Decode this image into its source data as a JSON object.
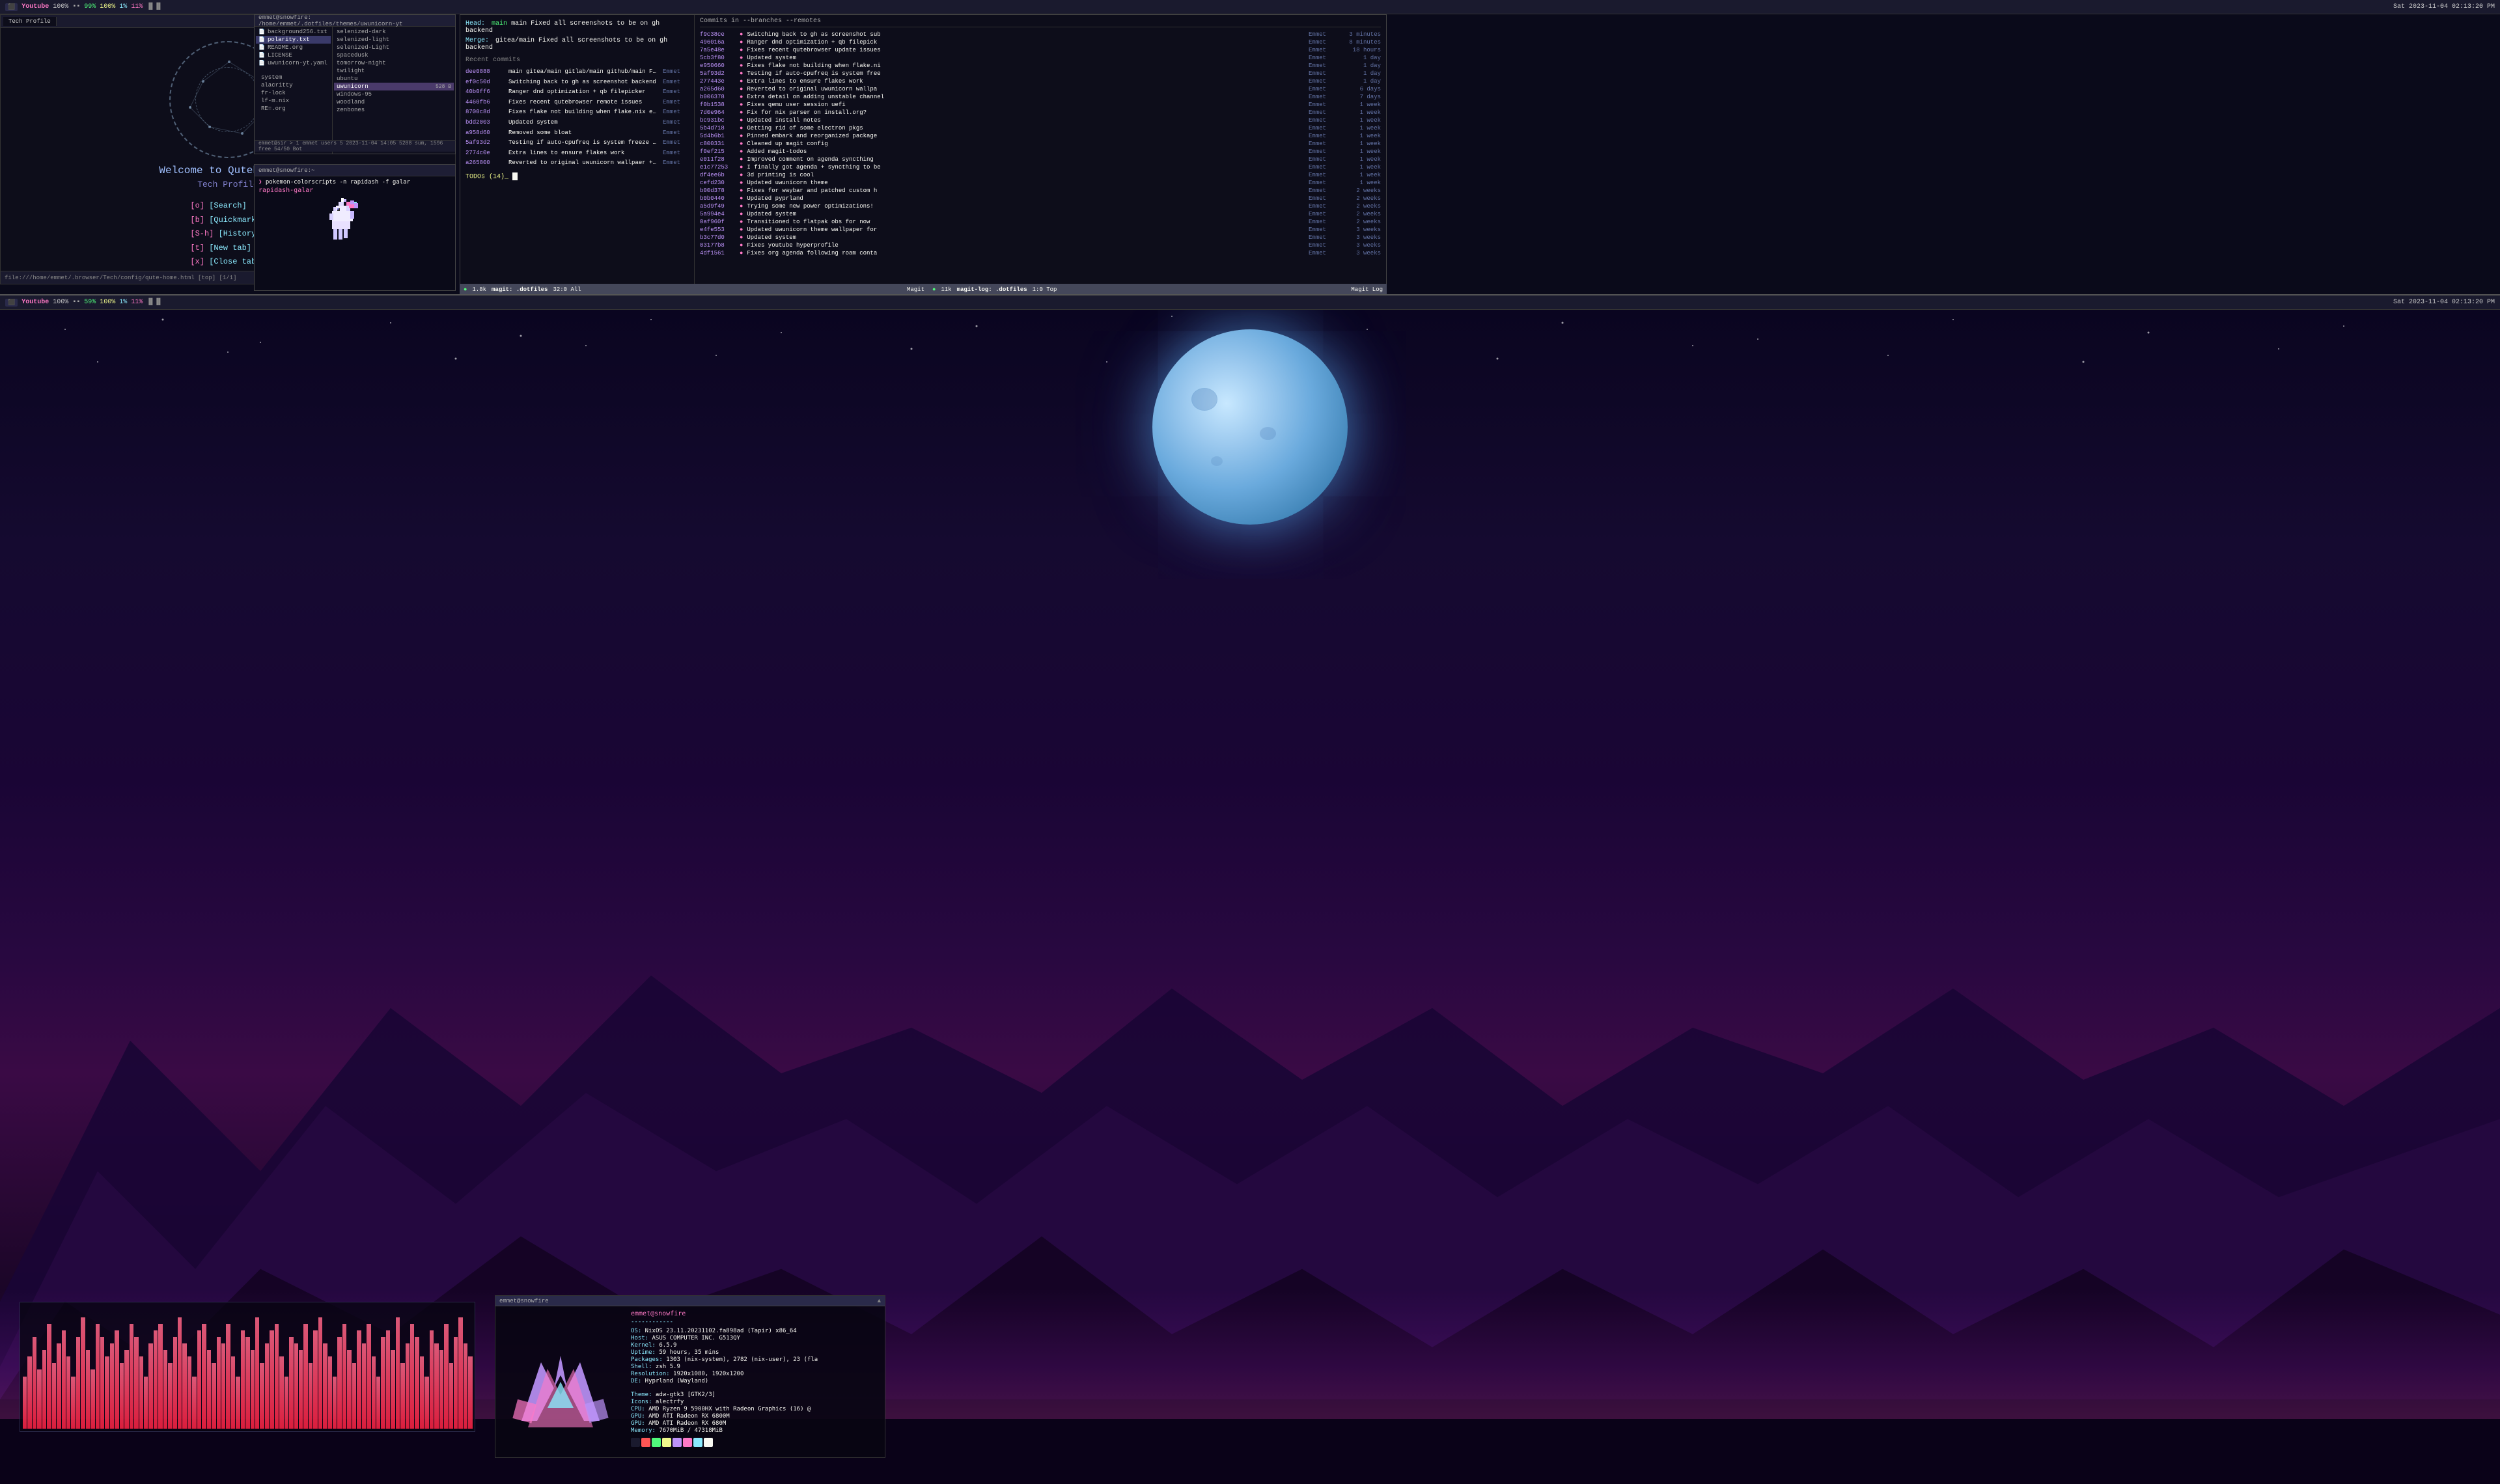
{
  "monitor1": {
    "topbar": {
      "left": {
        "app": "Youtube",
        "workspace": "100%",
        "cpu": "99%",
        "mem": "100%",
        "temp": "1%",
        "net": "11%"
      },
      "right": {
        "datetime": "Sat 2023-11-04 02:13:20 PM",
        "workspace_icons": "⬛▪▪"
      }
    }
  },
  "monitor2": {
    "topbar": {
      "left": {
        "app": "Youtube",
        "workspace": "100%",
        "cpu": "59%",
        "mem": "100%",
        "temp": "1%",
        "net": "11%"
      },
      "right": {
        "datetime": "Sat 2023-11-04 02:13:20 PM"
      }
    }
  },
  "qutebrowser": {
    "tab": "Tech Profile",
    "url": "file:///home/emmet/.browser/Tech/config/qute-home.html [top] [1/1]",
    "welcome": "Welcome to Qutebrowser",
    "subtitle": "Tech Profile",
    "menu": [
      {
        "key": "[o]",
        "label": "[Search]"
      },
      {
        "key": "[b]",
        "label": "[Quickmarks]"
      },
      {
        "key": "[S-h]",
        "label": "[History]"
      },
      {
        "key": "[t]",
        "label": "[New tab]"
      },
      {
        "key": "[x]",
        "label": "[Close tab]"
      }
    ]
  },
  "filemanager": {
    "title": "emmet@snowfire: /home/emmet/.dotfiles/themes/uwunicorn-yt",
    "left_items": [
      {
        "name": "background256.txt",
        "selected": false
      },
      {
        "name": "polarity.txt",
        "selected": true
      },
      {
        "name": "README.org",
        "selected": false
      },
      {
        "name": "LICENSE",
        "selected": false
      },
      {
        "name": "uwunicorn-yt.yaml",
        "selected": false
      }
    ],
    "right_items": [
      {
        "name": "system",
        "value": "selenized-dark"
      },
      {
        "name": "alacritty",
        "value": "selenized-light"
      },
      {
        "name": "fr-lock",
        "value": "selenized-Light"
      },
      {
        "name": "lf-m.nix",
        "value": "spacedusk"
      },
      {
        "name": "RE=.org",
        "value": "tomorrow-night"
      },
      {
        "name": "",
        "value": "twilight"
      },
      {
        "name": "",
        "value": "ubuntu"
      },
      {
        "name": "",
        "value": "uwunicorn"
      },
      {
        "name": "",
        "value": "windows-95"
      },
      {
        "name": "",
        "value": "woodland"
      },
      {
        "name": "",
        "value": "zenbones"
      }
    ],
    "statusbar": "emmet@sir > 1 emmet users 5 2023-11-04 14:05 5288 sum, 1596 free 54/50 Bot"
  },
  "pokemon_term": {
    "title": "emmet@snowfire:~",
    "prompt": "rapidash-galar",
    "command": "pokemon-colorscripts -n rapidash -f galar"
  },
  "git": {
    "head": "main Fixed all screenshots to be on gh backend",
    "merge": "gitea/main Fixed all screenshots to be on gh backend",
    "recent_commits_title": "Recent commits",
    "commits": [
      {
        "hash": "dee0888",
        "msg": "main gitea/main gitlab/main github/main Fixed all screenshots to be on",
        "author": "Emmet",
        "time": ""
      },
      {
        "hash": "ef0c50d",
        "msg": "Switching back to gh as screenshot backend",
        "author": "Emmet",
        "time": ""
      },
      {
        "hash": "40b0ff6",
        "msg": "Ranger dnd optimization + qb filepicker",
        "author": "Emmet",
        "time": ""
      },
      {
        "hash": "4460fb6",
        "msg": "Fixes recent qutebrowser remote issues",
        "author": "Emmet",
        "time": ""
      },
      {
        "hash": "8700c8d",
        "msg": "Fixes flake not building when flake.nix editor is vim, nvim or nano",
        "author": "Emmet",
        "time": ""
      },
      {
        "hash": "bdd2003",
        "msg": "Updated system",
        "author": "Emmet",
        "time": ""
      },
      {
        "hash": "a958d60",
        "msg": "Removed some bloat",
        "author": "Emmet",
        "time": ""
      },
      {
        "hash": "5af93d2",
        "msg": "Testing if auto-cpufreq is system freeze culprit",
        "author": "Emmet",
        "time": ""
      },
      {
        "hash": "2774c0e",
        "msg": "Extra lines to ensure flakes work",
        "author": "Emmet",
        "time": ""
      },
      {
        "hash": "a265800",
        "msg": "Reverted to original uwunicorn wallpaer + uwunicorn yt wallpaper vari",
        "author": "Emmet",
        "time": ""
      }
    ],
    "todos": "TODOs (14)_",
    "status_bar": {
      "left": "1.8k",
      "branch": "magit: .dotfiles",
      "right": "32:0 All",
      "mode": "Magit"
    }
  },
  "git_log": {
    "title": "Commits in --branches --remotes",
    "entries": [
      {
        "hash": "f9c38ce",
        "msg": "Switching back to gh as screenshot sub",
        "author": "Emmet",
        "time": "3 minutes"
      },
      {
        "hash": "496016a",
        "msg": "Ranger dnd optimization + qb filepick",
        "author": "Emmet",
        "time": "8 minutes"
      },
      {
        "hash": "7a5e48e",
        "msg": "Fixes recent qutebrowser update issues",
        "author": "Emmet",
        "time": "18 hours"
      },
      {
        "hash": "5cb3f80",
        "msg": "Updated system",
        "author": "Emmet",
        "time": "1 day"
      },
      {
        "hash": "e950660",
        "msg": "Fixes flake not building when flake.ni",
        "author": "Emmet",
        "time": "1 day"
      },
      {
        "hash": "5af93d2",
        "msg": "Testing if auto-cpufreq is system free",
        "author": "Emmet",
        "time": "1 day"
      },
      {
        "hash": "277443e",
        "msg": "Extra lines to ensure flakes work",
        "author": "Emmet",
        "time": "1 day"
      },
      {
        "hash": "a265d60",
        "msg": "Reverted to original uwunicorn wallpa",
        "author": "Emmet",
        "time": "6 days"
      },
      {
        "hash": "b006378",
        "msg": "Extra detail on adding unstable channel",
        "author": "Emmet",
        "time": "7 days"
      },
      {
        "hash": "f0b1538",
        "msg": "Fixes qemu user session uefi",
        "author": "Emmet",
        "time": "1 week"
      },
      {
        "hash": "7d0e964",
        "msg": "Fix for nix parser on install.org?",
        "author": "Emmet",
        "time": "1 week"
      },
      {
        "hash": "bc931bc",
        "msg": "Updated install notes",
        "author": "Emmet",
        "time": "1 week"
      },
      {
        "hash": "5b4d718",
        "msg": "Getting rid of some electron pkgs",
        "author": "Emmet",
        "time": "1 week"
      },
      {
        "hash": "5d4b6b1",
        "msg": "Pinned embark and reorganized package",
        "author": "Emmet",
        "time": "1 week"
      },
      {
        "hash": "c800331",
        "msg": "Cleaned up magit config",
        "author": "Emmet",
        "time": "1 week"
      },
      {
        "hash": "f0ef215",
        "msg": "Added magit-todos",
        "author": "Emmet",
        "time": "1 week"
      },
      {
        "hash": "e011f28",
        "msg": "Improved comment on agenda syncthing",
        "author": "Emmet",
        "time": "1 week"
      },
      {
        "hash": "e1c77253",
        "msg": "I finally got agenda + syncthing to be",
        "author": "Emmet",
        "time": "1 week"
      },
      {
        "hash": "df4ee6b",
        "msg": "3d printing is cool",
        "author": "Emmet",
        "time": "1 week"
      },
      {
        "hash": "cefd230",
        "msg": "Updated uwunicorn theme",
        "author": "Emmet",
        "time": "1 week"
      },
      {
        "hash": "b00d378",
        "msg": "Fixes for waybar and patched custom h",
        "author": "Emmet",
        "time": "2 weeks"
      },
      {
        "hash": "b0b0440",
        "msg": "Updated pyprland",
        "author": "Emmet",
        "time": "2 weeks"
      },
      {
        "hash": "a5d9f49",
        "msg": "Trying some new power optimizations!",
        "author": "Emmet",
        "time": "2 weeks"
      },
      {
        "hash": "5a994e4",
        "msg": "Updated system",
        "author": "Emmet",
        "time": "2 weeks"
      },
      {
        "hash": "0af960f",
        "msg": "Transitioned to flatpak obs for now",
        "author": "Emmet",
        "time": "2 weeks"
      },
      {
        "hash": "e4fe553",
        "msg": "Updated uwunicorn theme wallpaper for",
        "author": "Emmet",
        "time": "3 weeks"
      },
      {
        "hash": "b3c77d0",
        "msg": "Updated system",
        "author": "Emmet",
        "time": "3 weeks"
      },
      {
        "hash": "03177b8",
        "msg": "Fixes youtube hyperprofile",
        "author": "Emmet",
        "time": "3 weeks"
      },
      {
        "hash": "4df1561",
        "msg": "Fixes org agenda following roam conta",
        "author": "Emmet",
        "time": "3 weeks"
      }
    ],
    "status_bar": {
      "left": "11k",
      "branch": "magit-log: .dotfiles",
      "right": "1:0 Top",
      "mode": "Magit Log"
    }
  },
  "neofetch": {
    "title": "emmet@snowfire",
    "separator": "------------",
    "lines": [
      {
        "key": "OS",
        "val": "NixOS 23.11.20231102.fa898ad (Tapir) x86_64"
      },
      {
        "key": "Host",
        "val": "ASUS COMPUTER INC. G513QY"
      },
      {
        "key": "Kernel",
        "val": "6.5.9"
      },
      {
        "key": "Uptime",
        "val": "59 hours, 35 mins"
      },
      {
        "key": "Packages",
        "val": "1303 (nix-system), 2782 (nix-user), 23 (fla"
      },
      {
        "key": "Shell",
        "val": "zsh 5.9"
      },
      {
        "key": "Resolution",
        "val": "1920x1080, 1920x1200"
      },
      {
        "key": "DE",
        "val": "Hyprland (Wayland)"
      },
      {
        "key": "",
        "val": ""
      },
      {
        "key": "Theme",
        "val": "adw-gtk3 [GTK2/3]"
      },
      {
        "key": "Icons",
        "val": "alectrfy"
      },
      {
        "key": "CPU",
        "val": "AMD Ryzen 9 5900HX with Radeon Graphics (16) @"
      },
      {
        "key": "GPU",
        "val": "AMD ATI Radeon RX 6800M"
      },
      {
        "key": "GPU",
        "val": "AMD ATI Radeon RX 680M"
      },
      {
        "key": "Memory",
        "val": "7670MiB / 47318MiB"
      }
    ],
    "colors": [
      "#1a1a2e",
      "#ff5555",
      "#50fa7b",
      "#f1fa8c",
      "#bd93f9",
      "#ff79c6",
      "#8be9fd",
      "#f8f8f2"
    ]
  },
  "visualizer": {
    "bar_heights": [
      40,
      55,
      70,
      45,
      60,
      80,
      50,
      65,
      75,
      55,
      40,
      70,
      85,
      60,
      45,
      80,
      70,
      55,
      65,
      75,
      50,
      60,
      80,
      70,
      55,
      40,
      65,
      75,
      80,
      60,
      50,
      70,
      85,
      65,
      55,
      40,
      75,
      80,
      60,
      50,
      70,
      65,
      80,
      55,
      40,
      75,
      70,
      60,
      85,
      50,
      65,
      75,
      80,
      55,
      40,
      70,
      65,
      60,
      80,
      50,
      75,
      85,
      65,
      55,
      40,
      70,
      80,
      60,
      50,
      75,
      65,
      80,
      55,
      40,
      70,
      75,
      60,
      85,
      50,
      65,
      80,
      70,
      55,
      40,
      75,
      65,
      60,
      80,
      50,
      70,
      85,
      65,
      55
    ]
  }
}
